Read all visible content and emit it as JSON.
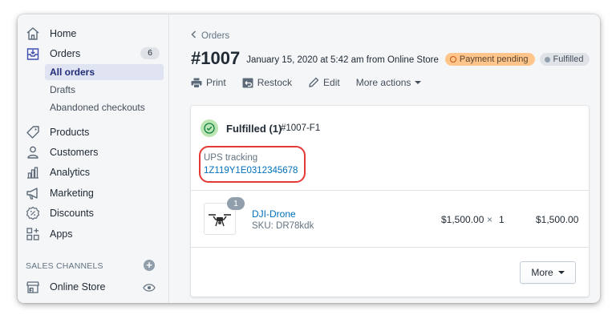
{
  "sidebar": {
    "items": [
      {
        "label": "Home",
        "icon": "home-icon"
      },
      {
        "label": "Orders",
        "icon": "orders-icon",
        "count": "6"
      },
      {
        "label": "Products",
        "icon": "tag-icon"
      },
      {
        "label": "Customers",
        "icon": "person-icon"
      },
      {
        "label": "Analytics",
        "icon": "bar-chart-icon"
      },
      {
        "label": "Marketing",
        "icon": "megaphone-icon"
      },
      {
        "label": "Discounts",
        "icon": "discount-icon"
      },
      {
        "label": "Apps",
        "icon": "apps-icon"
      }
    ],
    "order_subitems": [
      {
        "label": "All orders",
        "active": true
      },
      {
        "label": "Drafts",
        "active": false
      },
      {
        "label": "Abandoned checkouts",
        "active": false
      }
    ],
    "sales_channels_header": "SALES CHANNELS",
    "online_store": {
      "label": "Online Store",
      "icon": "store-icon"
    }
  },
  "main": {
    "breadcrumb": "Orders",
    "order_number": "#1007",
    "order_meta": "January 15, 2020 at 5:42 am from Online Store",
    "payment_badge": "Payment pending",
    "fulfillment_badge": "Fulfilled",
    "actions": {
      "print": "Print",
      "restock": "Restock",
      "edit": "Edit",
      "more_actions": "More actions"
    },
    "fulfillment": {
      "heading": "Fulfilled (1)",
      "id": "#1007-F1",
      "tracking_label": "UPS tracking",
      "tracking_number": "1Z119Y1E0312345678"
    },
    "line_item": {
      "quantity_badge": "1",
      "name": "DJI-Drone",
      "sku": "SKU: DR78kdk",
      "unit_price": "$1,500.00",
      "times": "×",
      "quantity": "1",
      "total": "$1,500.00"
    },
    "more_button": "More"
  },
  "colors": {
    "link": "#006fbb",
    "pending_badge": "#ffc58b",
    "fulfilled_badge": "#dfe3e8",
    "active_nav_bg": "#e0e3f2",
    "highlight_ring": "#e53935"
  }
}
